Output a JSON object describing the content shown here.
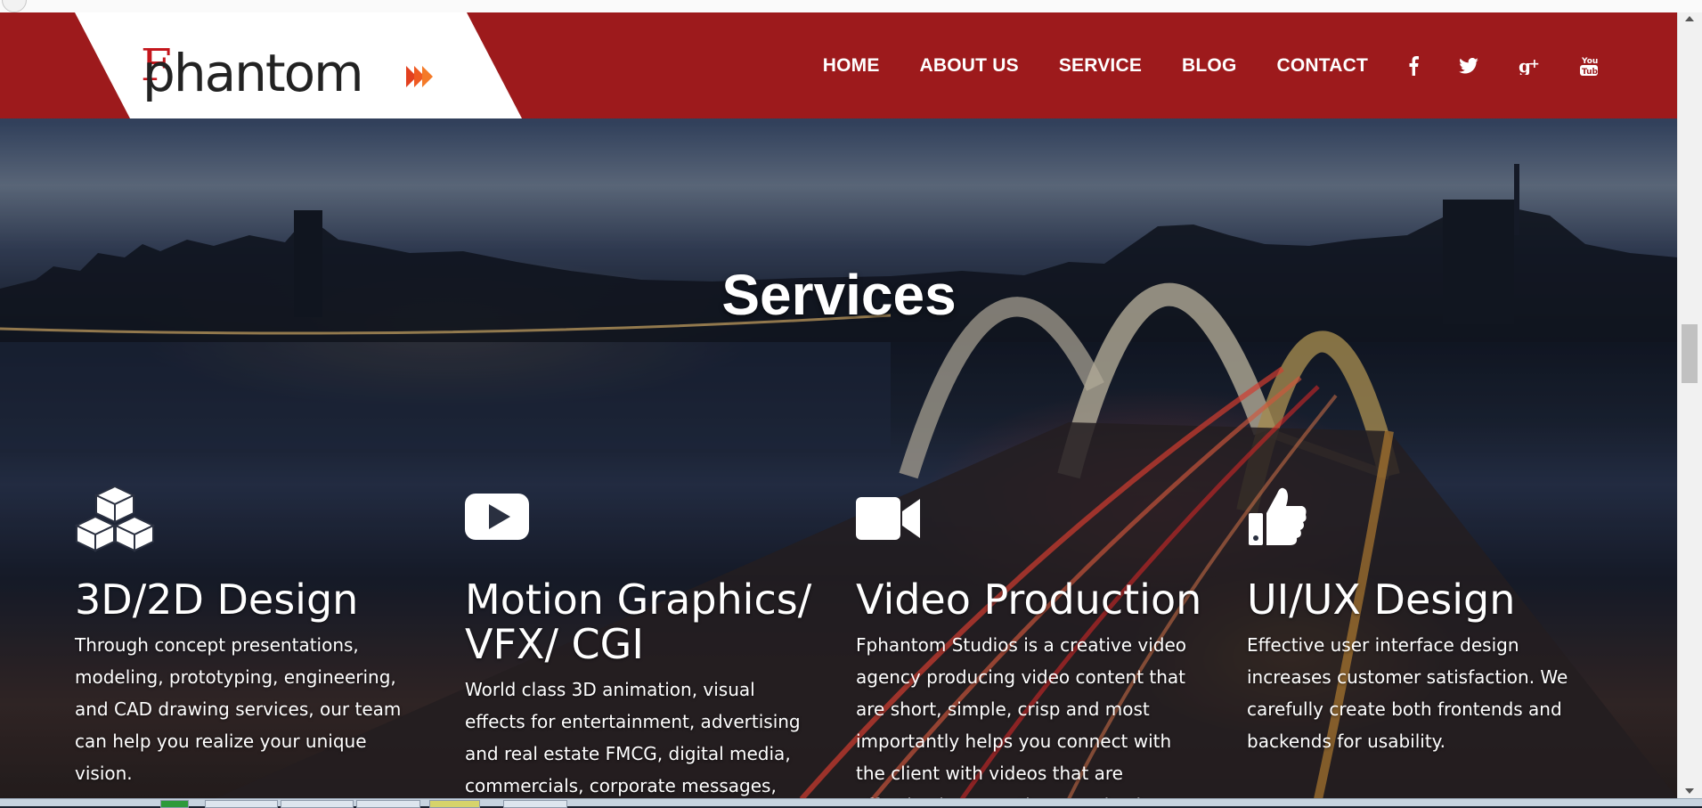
{
  "nav": {
    "logo_text": "phantom",
    "logo_f": "F",
    "links": [
      "HOME",
      "ABOUT US",
      "SERVICE",
      "BLOG",
      "CONTACT"
    ],
    "social_icons": [
      "facebook-icon",
      "twitter-icon",
      "google-plus-icon",
      "youtube-icon"
    ]
  },
  "section": {
    "title": "Services"
  },
  "services": [
    {
      "icon": "cubes-icon",
      "title": "3D/2D Design",
      "description": "Through concept presentations, modeling, prototyping, engineering, and CAD drawing services, our team can help you realize your unique vision."
    },
    {
      "icon": "youtube-play-icon",
      "title": "Motion Graphics/ VFX/ CGI",
      "description": "World class 3D animation, visual effects for entertainment, advertising and real estate FMCG, digital media, commercials, corporate messages,"
    },
    {
      "icon": "video-camera-icon",
      "title": "Video Production",
      "description": "Fphantom Studios is a creative video agency producing video content that are short, simple, crisp and most importantly helps you connect with the client with videos that are effective in promoting your business"
    },
    {
      "icon": "thumbs-up-icon",
      "title": "UI/UX Design",
      "description": "Effective user interface design increases customer satisfaction. We carefully create both frontends and backends for usability."
    }
  ],
  "colors": {
    "navbar": "#9d1a1c",
    "brand_red": "#c4161c",
    "text": "#ffffff"
  }
}
